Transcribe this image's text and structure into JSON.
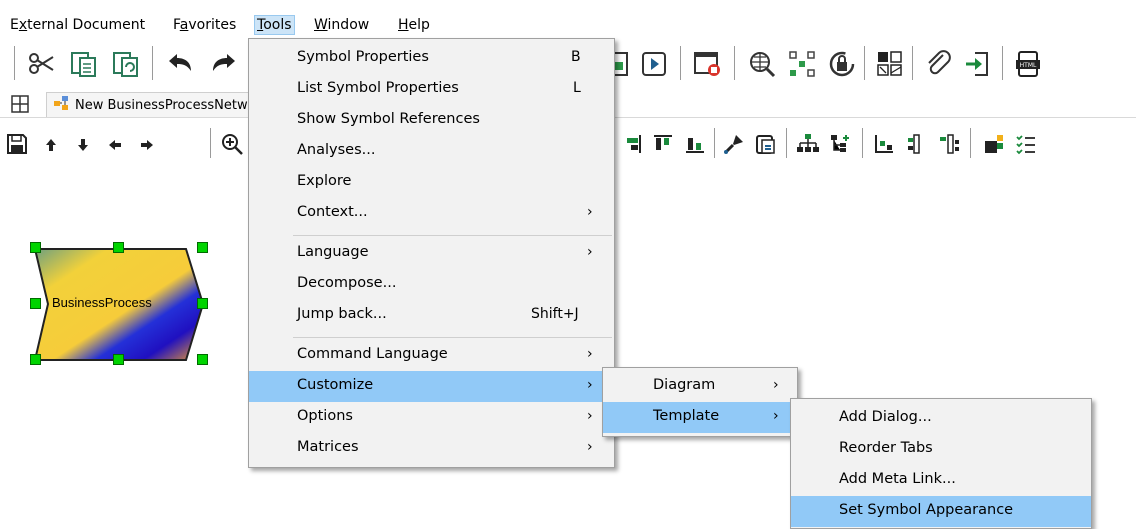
{
  "menubar": {
    "items": [
      {
        "label": "External Document",
        "key": "x"
      },
      {
        "label": "Favorites",
        "key": "a"
      },
      {
        "label": "Tools",
        "key": "T"
      },
      {
        "label": "Window",
        "key": "W"
      },
      {
        "label": "Help",
        "key": "H"
      }
    ]
  },
  "document_tab": {
    "label": "New BusinessProcessNetw"
  },
  "diagram": {
    "shape_label": "BusinessProcess"
  },
  "tools_menu": {
    "items": [
      {
        "label": "Symbol Properties",
        "shortcut": "B"
      },
      {
        "label": "List Symbol Properties",
        "shortcut": "L"
      },
      {
        "label": "Show Symbol References",
        "shortcut": ""
      },
      {
        "label": "Analyses...",
        "shortcut": ""
      },
      {
        "label": "Explore",
        "shortcut": ""
      },
      {
        "label": "Context...",
        "shortcut": "",
        "submenu": true
      },
      {
        "label": "Language",
        "shortcut": "",
        "submenu": true
      },
      {
        "label": "Decompose...",
        "shortcut": ""
      },
      {
        "label": "Jump back...",
        "shortcut": "Shift+J"
      },
      {
        "label": "Command Language",
        "shortcut": "",
        "submenu": true
      },
      {
        "label": "Customize",
        "shortcut": "",
        "submenu": true
      },
      {
        "label": "Options",
        "shortcut": "",
        "submenu": true
      },
      {
        "label": "Matrices",
        "shortcut": "",
        "submenu": true
      }
    ]
  },
  "customize_menu": {
    "items": [
      {
        "label": "Diagram",
        "submenu": true
      },
      {
        "label": "Template",
        "submenu": true
      }
    ]
  },
  "template_menu": {
    "items": [
      {
        "label": "Add Dialog..."
      },
      {
        "label": "Reorder Tabs"
      },
      {
        "label": "Add Meta Link..."
      },
      {
        "label": "Set Symbol Appearance"
      }
    ]
  },
  "submenu_arrow": "›",
  "colors": {
    "highlight": "#91c9f7",
    "menu_bg": "#f2f2f2",
    "handle": "#00d400"
  }
}
